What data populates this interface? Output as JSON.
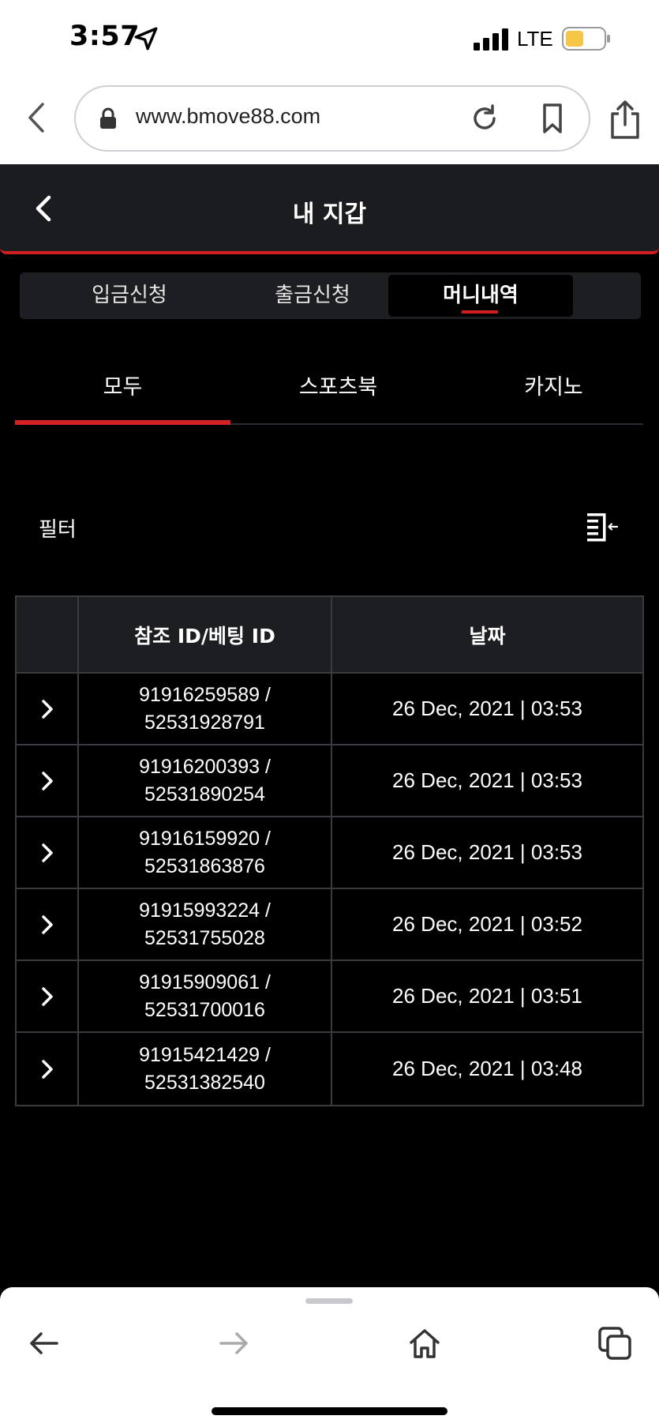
{
  "status_bar": {
    "time": "3:57",
    "network": "LTE",
    "icons": [
      "location-arrow-icon",
      "signal-icon",
      "battery-icon"
    ]
  },
  "browser": {
    "url": "www.bmove88.com",
    "icons": [
      "back-arrow-icon",
      "lock-icon",
      "reload-icon",
      "bookmark-icon",
      "share-icon"
    ]
  },
  "header": {
    "title": "내 지갑"
  },
  "segment_tabs": [
    {
      "label": "입금신청",
      "active": false
    },
    {
      "label": "출금신청",
      "active": false
    },
    {
      "label": "머니내역",
      "active": true
    }
  ],
  "sub_tabs": [
    {
      "label": "모두",
      "active": true
    },
    {
      "label": "스포츠북",
      "active": false
    },
    {
      "label": "카지노",
      "active": false
    }
  ],
  "filter": {
    "label": "필터"
  },
  "table": {
    "columns": [
      "",
      "참조 ID/베팅 ID",
      "날짜"
    ],
    "rows": [
      {
        "ref_id": "91916259589 /",
        "bet_id": "52531928791",
        "date": "26 Dec, 2021 | 03:53"
      },
      {
        "ref_id": "91916200393 /",
        "bet_id": "52531890254",
        "date": "26 Dec, 2021 | 03:53"
      },
      {
        "ref_id": "91916159920 /",
        "bet_id": "52531863876",
        "date": "26 Dec, 2021 | 03:53"
      },
      {
        "ref_id": "91915993224 /",
        "bet_id": "52531755028",
        "date": "26 Dec, 2021 | 03:52"
      },
      {
        "ref_id": "91915909061 /",
        "bet_id": "52531700016",
        "date": "26 Dec, 2021 | 03:51"
      },
      {
        "ref_id": "91915421429 /",
        "bet_id": "52531382540",
        "date": "26 Dec, 2021 | 03:48"
      }
    ]
  },
  "colors": {
    "accent": "#d11f1f",
    "header_bg": "#1b1c20",
    "page_bg": "#000000"
  }
}
